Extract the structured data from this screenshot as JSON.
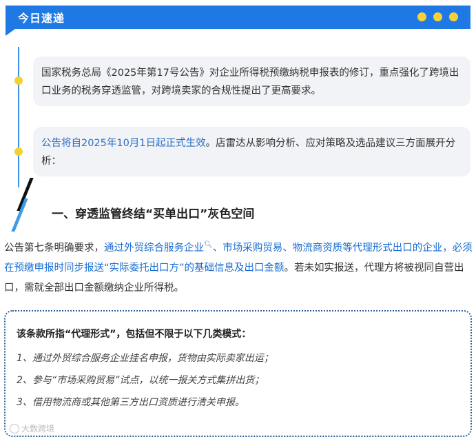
{
  "header": {
    "title": "今日速递",
    "dots": 3,
    "dot_color": "#f6d13a",
    "bar_color": "#1e79e4"
  },
  "cards": [
    {
      "text": "国家税务总局《2025年第17号公告》对企业所得税预缴纳税申报表的修订，重点强化了跨境出口业务的税务穿透监管，对跨境卖家的合规性提出了更高要求。"
    },
    {
      "highlight": "公告将自2025年10月1日起正式生效",
      "text": "。店雷达从影响分析、应对策略及选品建议三方面展开分析："
    }
  ],
  "section": {
    "title": "一、穿透监管终结“买单出口”灰色空间"
  },
  "paragraph": {
    "prefix": "公告第七条明确要求，",
    "link": "通过外贸综合服务企业",
    "highlight": "、市场采购贸易、物流商资质等代理形式出口的企业，必须在预缴申报时同步报送“实际委托出口方”的基础信息及出口金额",
    "suffix": "。若未如实报送，代理方将被视同自营出口，需就全部出口金额缴纳企业所得税。"
  },
  "box": {
    "title": "该条款所指“代理形式”，包括但不限于以下几类模式：",
    "items": [
      "1、通过外贸综合服务企业挂名申报，货物由实际卖家出运；",
      "2、参与“市场采购贸易”试点，以统一报关方式集拼出货；",
      "3、借用物流商或其他第三方出口资质进行清关申报。"
    ]
  },
  "watermark": {
    "text": "大数跨境"
  }
}
